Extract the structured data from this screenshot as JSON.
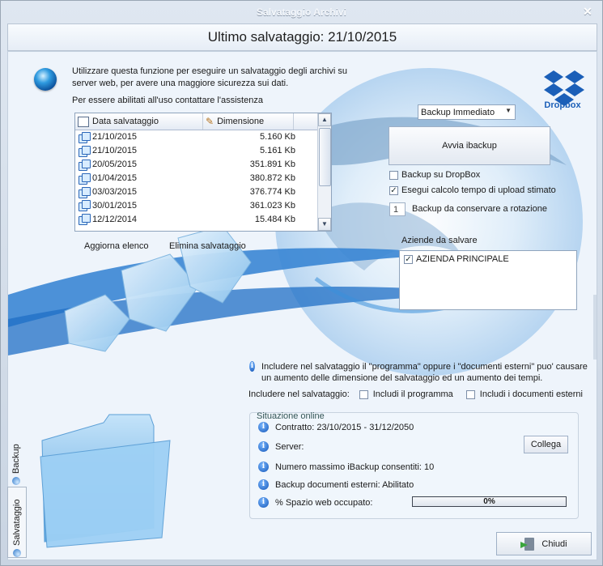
{
  "window": {
    "title": "Salvataggio Archivi"
  },
  "header": {
    "title": "Ultimo salvataggio: 21/10/2015"
  },
  "intro": {
    "text": "Utilizzare questa funzione per eseguire un salvataggio degli archivi su server web, per avere una maggiore sicurezza sui dati.",
    "contact": "Per essere abilitati all'uso contattare l'assistenza"
  },
  "backup_list": {
    "columns": [
      "Data salvataggio",
      "Dimensione"
    ],
    "rows": [
      {
        "date": "21/10/2015",
        "size": "5.160 Kb"
      },
      {
        "date": "21/10/2015",
        "size": "5.161 Kb"
      },
      {
        "date": "20/05/2015",
        "size": "351.891 Kb"
      },
      {
        "date": "01/04/2015",
        "size": "380.872 Kb"
      },
      {
        "date": "03/03/2015",
        "size": "376.774 Kb"
      },
      {
        "date": "30/01/2015",
        "size": "361.023 Kb"
      },
      {
        "date": "12/12/2014",
        "size": "15.484 Kb"
      }
    ]
  },
  "actions": {
    "refresh": "Aggiorna elenco",
    "delete": "Elimina salvataggio"
  },
  "dropbox": {
    "label": "Dropbox",
    "icon": "dropbox-icon",
    "color": "#1b5fb8"
  },
  "backup_mode": {
    "selected": "Backup Immediato"
  },
  "start_button": {
    "label": "Avvia ibackup"
  },
  "options": {
    "dropbox_backup": {
      "label": "Backup su DropBox",
      "checked": false
    },
    "upload_estimate": {
      "label": "Esegui calcolo tempo di upload stimato",
      "checked": true
    },
    "rotation_count": "1",
    "rotation_label": "Backup da conservare a rotazione"
  },
  "companies": {
    "label": "Aziende da salvare",
    "items": [
      {
        "name": "AZIENDA PRINCIPALE",
        "checked": true
      }
    ]
  },
  "warning": {
    "text": "Includere nel salvataggio il \"programma\" oppure i \"documenti esterni\" puo' causare un aumento delle dimensione del salvataggio ed un aumento dei tempi."
  },
  "include": {
    "label": "Includere nel salvataggio:",
    "program": "Includi il programma",
    "external_docs": "Includi i documenti esterni"
  },
  "online": {
    "title": "Situazione online",
    "contract": "Contratto: 23/10/2015 - 31/12/2050",
    "server": "Server:",
    "connect_button": "Collega",
    "max_backups": "Numero massimo iBackup consentiti: 10",
    "external_docs": "Backup documenti esterni: Abilitato",
    "space_label": "% Spazio web occupato:",
    "space_text": "0%",
    "space_value": 0
  },
  "close_button": {
    "label": "Chiudi"
  },
  "side_tabs": [
    "Backup",
    "Salvataggio"
  ]
}
